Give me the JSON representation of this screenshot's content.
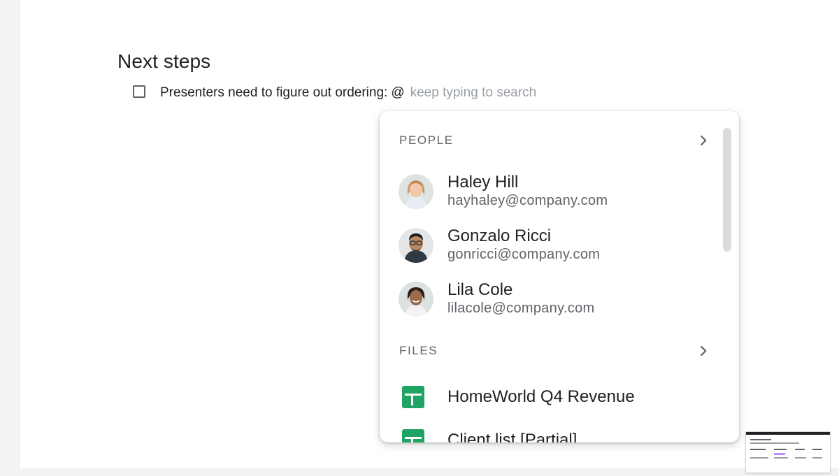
{
  "document": {
    "heading": "Next steps",
    "task": {
      "text": "Presenters need to figure out ordering:",
      "mention_trigger": "@",
      "search_hint": "keep typing to search",
      "checked": false
    }
  },
  "mention_menu": {
    "people_header": "PEOPLE",
    "people": [
      {
        "name": "Haley Hill",
        "email": "hayhaley@company.com"
      },
      {
        "name": "Gonzalo Ricci",
        "email": "gonricci@company.com"
      },
      {
        "name": "Lila Cole",
        "email": "lilacole@company.com"
      }
    ],
    "files_header": "FILES",
    "files": [
      {
        "name": "HomeWorld Q4 Revenue",
        "icon": "google-sheets-icon"
      },
      {
        "name": "Client list [Partial]",
        "icon": "google-sheets-icon"
      }
    ]
  },
  "colors": {
    "sheets_green": "#1fa463",
    "text_primary": "#202124",
    "text_secondary": "#5f6368",
    "hint_gray": "#9aa0a6"
  },
  "icons": {
    "section_chevron": "chevron-right-icon",
    "task_checkbox": "checkbox-unchecked-icon"
  }
}
